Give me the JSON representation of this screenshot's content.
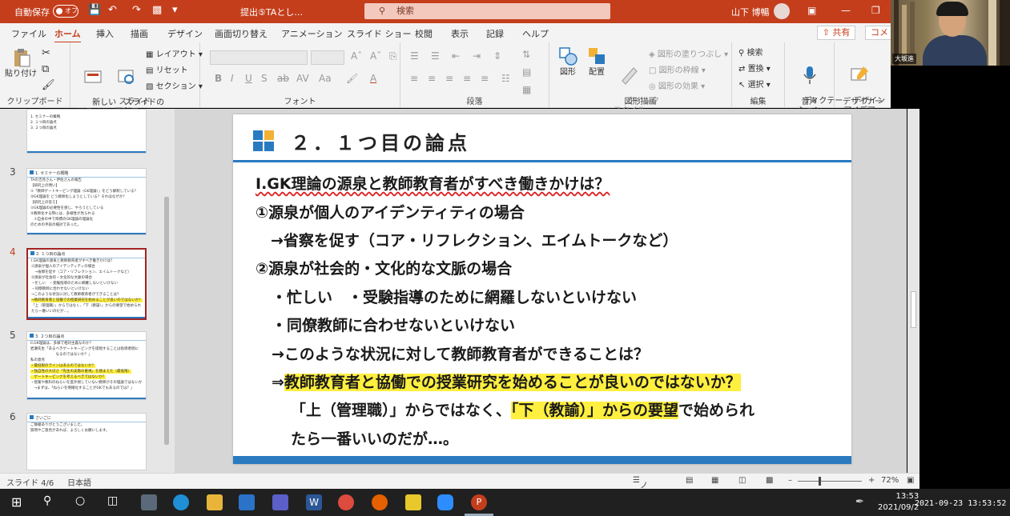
{
  "titlebar": {
    "autosave": "自動保存",
    "autosave_state": "オフ",
    "doc_title": "提出⑤TAとし…",
    "search_placeholder": "検索",
    "user_name": "山下 博暢",
    "accent": "#c43e1c"
  },
  "tabs": [
    {
      "label": "ファイル"
    },
    {
      "label": "ホーム"
    },
    {
      "label": "挿入"
    },
    {
      "label": "描画"
    },
    {
      "label": "デザイン"
    },
    {
      "label": "画面切り替え"
    },
    {
      "label": "アニメーション"
    },
    {
      "label": "スライド ショー"
    },
    {
      "label": "校閲"
    },
    {
      "label": "表示"
    },
    {
      "label": "記録"
    },
    {
      "label": "ヘルプ"
    }
  ],
  "share_label": "共有",
  "comment_label": "コメ",
  "ribbon": {
    "clipboard": {
      "label": "クリップボード",
      "paste": "貼り付け"
    },
    "slides": {
      "label": "スライド",
      "new_slide": "新しい\nスライド",
      "reuse": "スライドの\n再利用",
      "layout": "レイアウト",
      "reset": "リセット",
      "section": "セクション"
    },
    "font": {
      "label": "フォント",
      "bold": "B",
      "italic": "I",
      "underline": "U",
      "strike": "S",
      "shadow": "ab",
      "spacing": "AV",
      "case": "Aa",
      "color": "A"
    },
    "paragraph": {
      "label": "段落"
    },
    "drawing": {
      "label": "図形描画",
      "shapes": "図形",
      "arrange": "配置",
      "quick_styles": "クイック\nスタイル",
      "fill": "図形の塗りつぶし",
      "outline": "図形の枠線",
      "effects": "図形の効果"
    },
    "editing": {
      "label": "編集",
      "find": "検索",
      "replace": "置換",
      "select": "選択"
    },
    "voice": {
      "label": "音声",
      "dictate": "ディクテー\nション"
    },
    "designer": {
      "label": "デザイナー",
      "ideas": "デザイン\nアイデア"
    }
  },
  "thumbnails": [
    {
      "num": "",
      "lines": [
        "1. セミナーの概略",
        "2. １つ目の論点",
        "3. ２つ目の論点"
      ]
    },
    {
      "num": "3",
      "title": "1. セミナーの概略",
      "lines": [
        "TAの吉見さん・伊佐さんの報告",
        "【研究上の問い】",
        "①「教師ゲートキーピング理論（GK理論）」をどう解釈している？",
        "②GK理論を どう教師化しようとしている？それはなぜか？",
        "【研究上の答え】",
        "①GK理論の必要性を感じ、やろうとしている",
        "②教師化する際には、多様性が見られる",
        "　①自身の中で目標のGK理論の理論化",
        "のための手段の検討であった。"
      ]
    },
    {
      "num": "4",
      "title": "2. １つ目の論点",
      "lines": [
        "I.GK理論の源泉と教師教育者がすべき働きかけは？",
        "①源泉が個人のアイデンティティの場合",
        "　→省察を促す（コア・リフレクション、エイムトークなど）",
        "②源泉が社会的・文化的な文脈の場合",
        "・忙しい　・受験指導のために網羅しないといけない",
        "・同僚教師に合わせないといけない",
        "→このような状況に対して教師教育者ができることは？",
        "⇒教師教育者と協働での授業研究を始めることが良いのではないか？",
        "「上（管理職）」からではなく、「下（教諭）」からの要望で始められ",
        "たら一番いいのだが…。"
      ]
    },
    {
      "num": "5",
      "title": "3. ２つ目の論点",
      "lines": [
        "II.GK理論は、多様で相対主義なのか？",
        "岩瀬先生「あるべきゲートキーピングを提唱することは指導者側に",
        "　　　　　　　なるのではないか？」",
        "私の意見",
        "・最低限のラインはあるのではないか？",
        "・独自性の大切さ「先生の実態の重視」を踏まえた（最低限）",
        "　ゲートキーピングを考えるべきではないか？",
        "・授業や教科のねらいを度外視していない教師がその理論ではないか",
        "　→まずは、「ねらいを明確化することがGKでもあるのでは？」"
      ]
    },
    {
      "num": "6",
      "title": "さいごに",
      "lines": [
        "",
        "ご静聴ありがとうございました。",
        "質問やご意見があれば、よろしくお願いします。"
      ]
    }
  ],
  "slide": {
    "title": "２．１つ目の論点",
    "lines": [
      {
        "text": "Ⅰ.GK理論の源泉と教師教育者がすべき働きかけは？"
      },
      {
        "text": "①源泉が個人のアイデンティティの場合"
      },
      {
        "text": "　→省察を促す（コア・リフレクション、エイムトークなど）"
      },
      {
        "text": "②源泉が社会的・文化的な文脈の場合"
      },
      {
        "text": "・忙しい　・受験指導のために網羅しないといけない"
      },
      {
        "text": "・同僚教師に合わせないといけない"
      },
      {
        "text": "→このような状況に対して教師教育者ができることは？"
      },
      {
        "prefix": "⇒",
        "highlight": "教師教育者と協働での授業研究を始めることが良いのではないか？"
      },
      {
        "pre": "「上（管理職）」からではなく、",
        "highlight": "「下（教諭）」からの要望",
        "post": "で始められ"
      },
      {
        "text": "たら一番いいのだが…。"
      }
    ]
  },
  "status": {
    "slide_counter": "スライド 4/6",
    "language": "日本語",
    "notes": "ノート",
    "zoom": "72%"
  },
  "taskbar": {
    "time": "13:53",
    "date": "2021/09/2"
  },
  "timestamp": "2021-09-23 13:53:52",
  "webcam_name": "大坂進"
}
